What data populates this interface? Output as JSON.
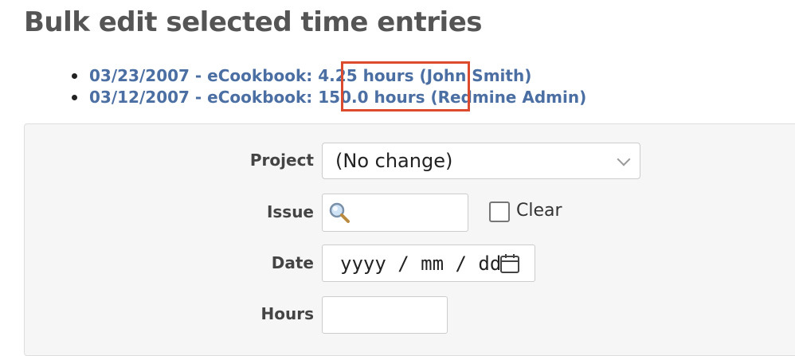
{
  "page": {
    "title": "Bulk edit selected time entries"
  },
  "entries": [
    {
      "date": "03/23/2007",
      "project": "eCookbook",
      "hours": "4.25 hours",
      "user": "(John Smith)"
    },
    {
      "date": "03/12/2007",
      "project": "eCookbook",
      "hours": "150.0 hours",
      "user": "(Redmine Admin)"
    }
  ],
  "separators": {
    "dash": " - ",
    "colon": ": "
  },
  "form": {
    "project_label": "Project",
    "project_value": "(No change)",
    "issue_label": "Issue",
    "issue_value": "",
    "clear_label": "Clear",
    "clear_checked": false,
    "date_label": "Date",
    "date_placeholder": "yyyy / mm / dd",
    "hours_label": "Hours",
    "hours_value": ""
  },
  "colors": {
    "link": "#4b6fa3",
    "highlight": "#dd4b2e",
    "heading": "#555555"
  },
  "icons": {
    "issue_search": "magnifier-icon",
    "date": "calendar-icon",
    "select": "chevron-down-icon"
  }
}
